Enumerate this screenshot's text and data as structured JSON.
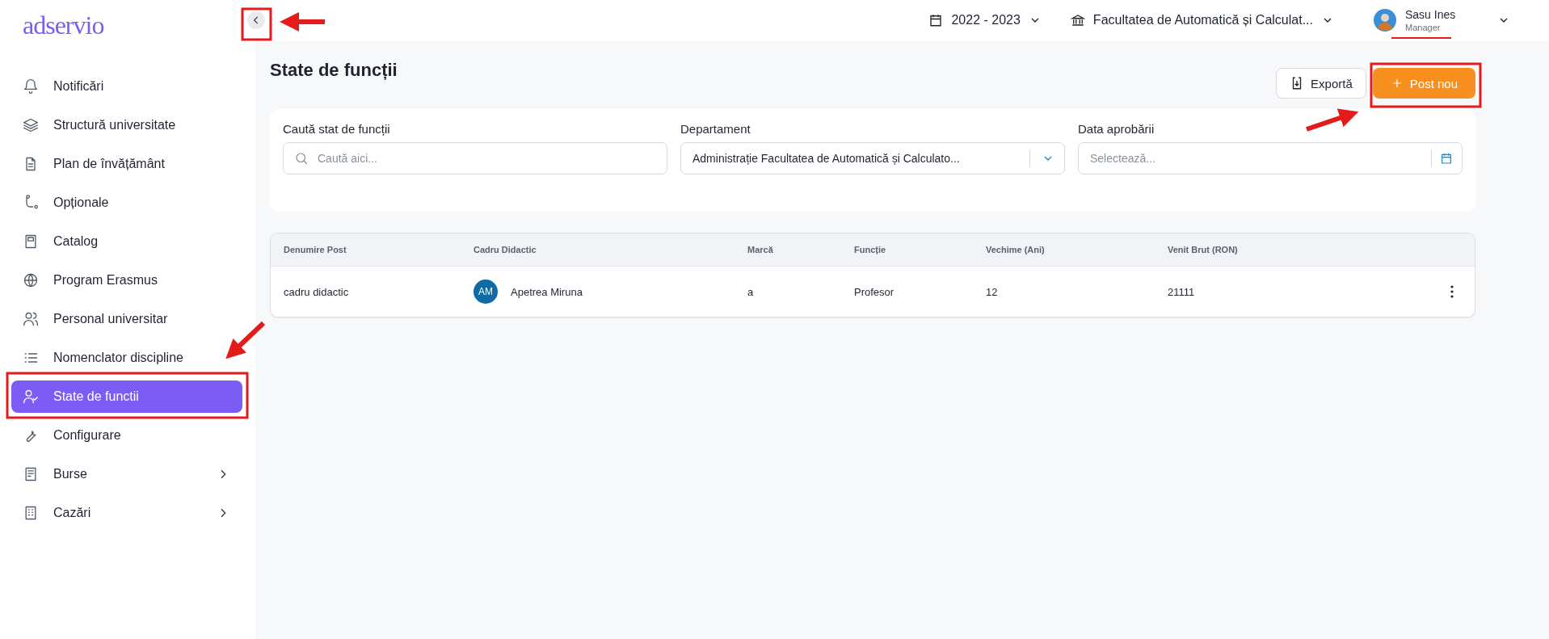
{
  "logo": "adservio",
  "topbar": {
    "year": "2022 - 2023",
    "faculty": "Facultatea de Automatică și Calculat...",
    "user": {
      "name": "Sasu Ines",
      "role": "Manager"
    }
  },
  "sidebar": {
    "items": [
      {
        "label": "Notificări",
        "selected": false,
        "expandable": false
      },
      {
        "label": "Structură universitate",
        "selected": false,
        "expandable": false
      },
      {
        "label": "Plan de învățământ",
        "selected": false,
        "expandable": false
      },
      {
        "label": "Opționale",
        "selected": false,
        "expandable": false
      },
      {
        "label": "Catalog",
        "selected": false,
        "expandable": false
      },
      {
        "label": "Program Erasmus",
        "selected": false,
        "expandable": false
      },
      {
        "label": "Personal universitar",
        "selected": false,
        "expandable": false
      },
      {
        "label": "Nomenclator discipline",
        "selected": false,
        "expandable": false
      },
      {
        "label": "State de functii",
        "selected": true,
        "expandable": false
      },
      {
        "label": "Configurare",
        "selected": false,
        "expandable": false
      },
      {
        "label": "Burse",
        "selected": false,
        "expandable": true
      },
      {
        "label": "Cazări",
        "selected": false,
        "expandable": true
      }
    ]
  },
  "page": {
    "title": "State de funcții",
    "buttons": [
      {
        "label": "Exportă",
        "kind": "export"
      },
      {
        "label": "Post nou",
        "kind": "primary"
      }
    ]
  },
  "filters": [
    {
      "label": "Caută stat de funcții",
      "kind": "search",
      "placeholder": "Caută aici..."
    },
    {
      "label": "Departament",
      "kind": "select",
      "value": "Administrație Facultatea de Automatică și Calculato..."
    },
    {
      "label": "Data aprobării",
      "kind": "date",
      "placeholder": "Selectează..."
    }
  ],
  "table": {
    "columns": [
      "Denumire Post",
      "Cadru Didactic",
      "Marcă",
      "Funcție",
      "Vechime (Ani)",
      "Venit Brut (RON)"
    ],
    "rows": [
      {
        "post": "cadru didactic",
        "initials": "AM",
        "teacher": "Apetrea Miruna",
        "marca": "a",
        "functie": "Profesor",
        "vechime": "12",
        "venit": "21111"
      }
    ]
  }
}
